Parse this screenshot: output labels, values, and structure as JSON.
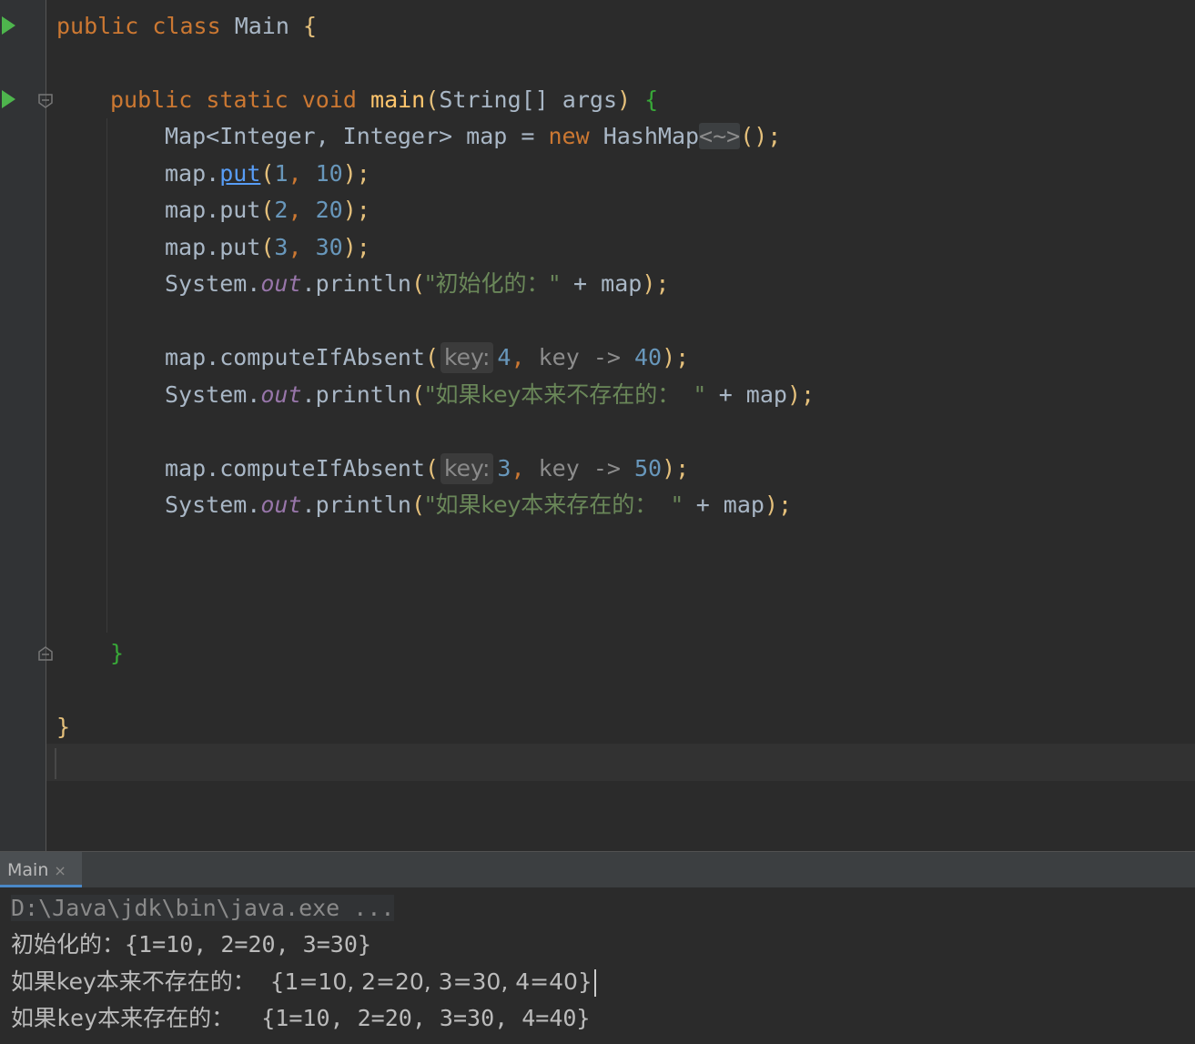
{
  "editor": {
    "lines": {
      "l1": {
        "kw1": "public",
        "kw2": "class",
        "name": "Main",
        "brace": "{"
      },
      "l3": {
        "kw1": "public",
        "kw2": "static",
        "kw3": "void",
        "fn": "main",
        "open": "(",
        "type": "String[]",
        "param": "args",
        "close": ")",
        "brace": "{"
      },
      "l4": {
        "type": "Map<Integer, Integer>",
        "var": "map =",
        "kw": "new",
        "cls": "HashMap",
        "diamond": "<~>",
        "end": "();"
      },
      "l5": {
        "obj": "map.",
        "fn": "put",
        "open": "(",
        "a": "1",
        "comma": ",",
        "b": "10",
        "end": ");"
      },
      "l6": {
        "obj": "map.put",
        "open": "(",
        "a": "2",
        "comma": ",",
        "b": "20",
        "end": ");"
      },
      "l7": {
        "obj": "map.put",
        "open": "(",
        "a": "3",
        "comma": ",",
        "b": "30",
        "end": ");"
      },
      "l8": {
        "sys": "System.",
        "field": "out",
        "call": ".println",
        "open": "(",
        "str": "\"初始化的：\"",
        "rest": " + map",
        "end": ");"
      },
      "l10": {
        "call": "map.computeIfAbsent",
        "open": "(",
        "hint": "key:",
        "a": "4",
        "comma": ",",
        "lambda": "key ->",
        "b": "40",
        "end": ");"
      },
      "l11": {
        "sys": "System.",
        "field": "out",
        "call": ".println",
        "open": "(",
        "str": "\"如果key本来不存在的：  \"",
        "rest": " + map",
        "end": ");"
      },
      "l13": {
        "call": "map.computeIfAbsent",
        "open": "(",
        "hint": "key:",
        "a": "3",
        "comma": ",",
        "lambda": "key ->",
        "b": "50",
        "end": ");"
      },
      "l14": {
        "sys": "System.",
        "field": "out",
        "call": ".println",
        "open": "(",
        "str": "\"如果key本来存在的：  \"",
        "rest": " + map",
        "end": ");"
      },
      "l18": {
        "brace": "}"
      },
      "l20": {
        "brace": "}"
      }
    }
  },
  "run_panel": {
    "tab_label": "Main",
    "tab_close": "×",
    "output": [
      "D:\\Java\\jdk\\bin\\java.exe ...",
      "初始化的：{1=10, 2=20, 3=30}",
      "如果key本来不存在的：  {1=10, 2=20, 3=30, 4=40}",
      "如果key本来存在的：  {1=10, 2=20, 3=30, 4=40}"
    ]
  },
  "colors": {
    "background": "#2b2b2b",
    "gutter": "#313335",
    "keyword": "#cc7832",
    "method": "#ffc66d",
    "number": "#6897bb",
    "string": "#6a8759",
    "field": "#9876aa",
    "run_icon": "#4eb54d",
    "tab_accent": "#4a88c7"
  },
  "icons": [
    "run-gutter-icon",
    "fold-gutter-icon",
    "close-icon"
  ]
}
